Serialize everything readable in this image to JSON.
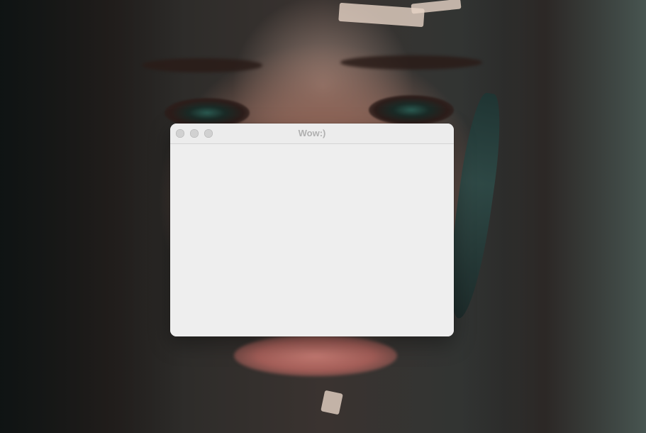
{
  "window": {
    "title": "Wow:)",
    "controls": [
      {
        "name": "close-button",
        "icon": "close-icon"
      },
      {
        "name": "minimize-button",
        "icon": "minimize-icon"
      },
      {
        "name": "zoom-button",
        "icon": "zoom-icon"
      }
    ],
    "content_background": "#eeeeee",
    "inactive_control_color": "#d1d1d1"
  },
  "wallpaper": {
    "subject": "woman-portrait-wallpaper"
  }
}
